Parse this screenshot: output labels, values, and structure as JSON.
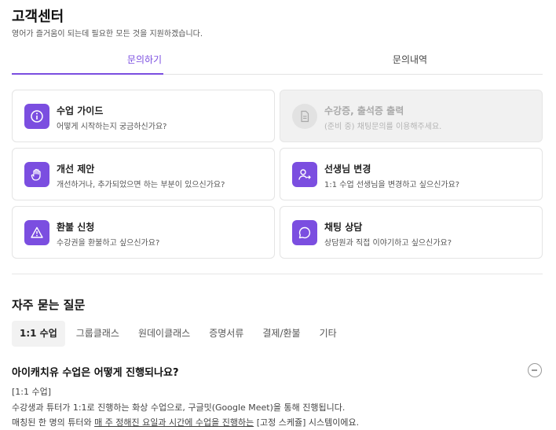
{
  "header": {
    "title": "고객센터",
    "subtitle": "영어가 즐거움이 되는데 필요한 모든 것을 지원하겠습니다."
  },
  "tabs": [
    {
      "label": "문의하기",
      "active": true
    },
    {
      "label": "문의내역",
      "active": false
    }
  ],
  "cards": [
    {
      "title": "수업 가이드",
      "desc": "어떻게 시작하는지 궁금하신가요?",
      "icon": "info-icon"
    },
    {
      "title": "수강증, 출석증 출력",
      "desc": "(준비 중) 채팅문의를 이용해주세요.",
      "icon": "document-icon",
      "disabled": true
    },
    {
      "title": "개선 제안",
      "desc": "개선하거나, 추가되었으면 하는 부분이 있으신가요?",
      "icon": "hand-icon"
    },
    {
      "title": "선생님 변경",
      "desc": "1:1 수업 선생님을 변경하고 싶으신가요?",
      "icon": "user-change-icon"
    },
    {
      "title": "환불 신청",
      "desc": "수강권을 환불하고 싶으신가요?",
      "icon": "warning-icon"
    },
    {
      "title": "채팅 상담",
      "desc": "상담원과 직접 이야기하고 싶으신가요?",
      "icon": "chat-icon"
    }
  ],
  "faq": {
    "title": "자주 묻는 질문",
    "tabs": [
      "1:1 수업",
      "그룹클래스",
      "원데이클래스",
      "증명서류",
      "결제/환불",
      "기타"
    ],
    "active_tab": "1:1 수업",
    "question": "아이캐치유 수업은 어떻게 진행되나요?",
    "answer": {
      "line1": "[1:1 수업]",
      "line2": "수강생과 튜터가 1:1로 진행하는 화상 수업으로, 구글밋(Google Meet)을 통해 진행됩니다.",
      "line3_pre": "매칭된 한 명의 튜터와 ",
      "line3_ul": "매 주 정해진 요일과 시간에 수업을 진행하는",
      "line3_post": " [고정 스케쥴] 시스템이에요."
    }
  },
  "colors": {
    "accent": "#7b4ee0",
    "disabled_bg": "#f1f1f1"
  }
}
